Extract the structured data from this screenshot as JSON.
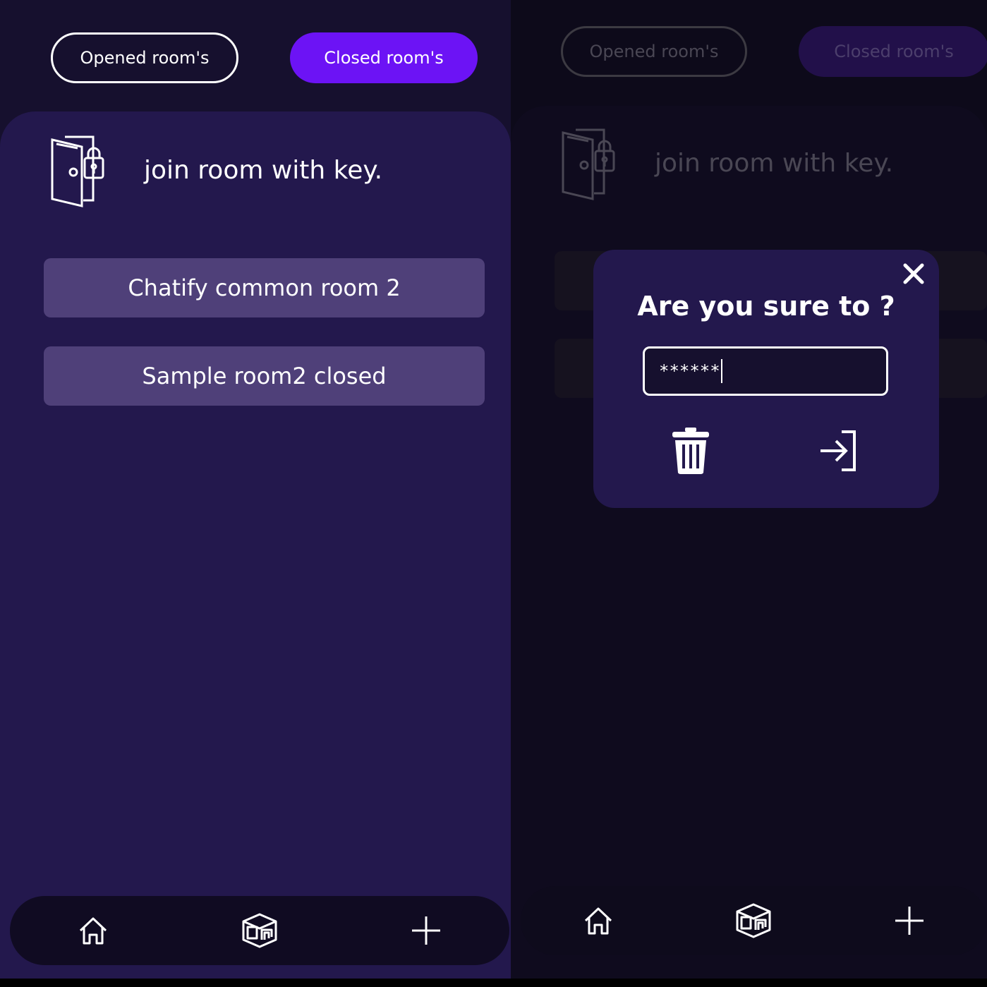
{
  "tabs": {
    "opened": "Opened room's",
    "closed": "Closed room's"
  },
  "join": {
    "label": "join room with key."
  },
  "rooms": [
    {
      "name": "Chatify common room 2"
    },
    {
      "name": "Sample room2 closed"
    }
  ],
  "modal": {
    "title": "Are you sure to ?",
    "password_value": "******"
  },
  "nav": {
    "items": [
      "home-icon",
      "rooms-icon",
      "plus-icon"
    ]
  },
  "colors": {
    "accent": "#6c13f5",
    "background": "#16102e",
    "card": "#23184d",
    "room_button": "#4f4079"
  }
}
